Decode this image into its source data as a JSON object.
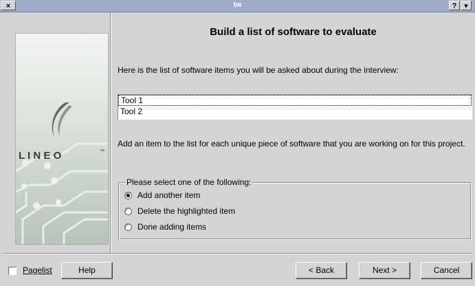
{
  "window": {
    "title": "tw",
    "close_glyph": "×",
    "help_glyph": "?",
    "menu_glyph": "▾"
  },
  "page": {
    "title": "Build a list of software to evaluate",
    "intro": "Here is the list of software items you will be asked about during the interview:",
    "list_items": [
      "Tool 1",
      "Tool 2"
    ],
    "add_description": "Add an item to the list for each unique piece of software that you are working on for this project.",
    "group_label": "Please select one of the following:",
    "options": [
      {
        "label": "Add another item",
        "checked": true
      },
      {
        "label": "Delete the highlighted item",
        "checked": false
      },
      {
        "label": "Done adding items",
        "checked": false
      }
    ]
  },
  "side_image": {
    "logo_text": "L I N E O",
    "trademark": "™"
  },
  "footer": {
    "pagelist_label": "Pagelist",
    "help_label": "Help",
    "back_label": "< Back",
    "next_label": "Next >",
    "cancel_label": "Cancel"
  }
}
